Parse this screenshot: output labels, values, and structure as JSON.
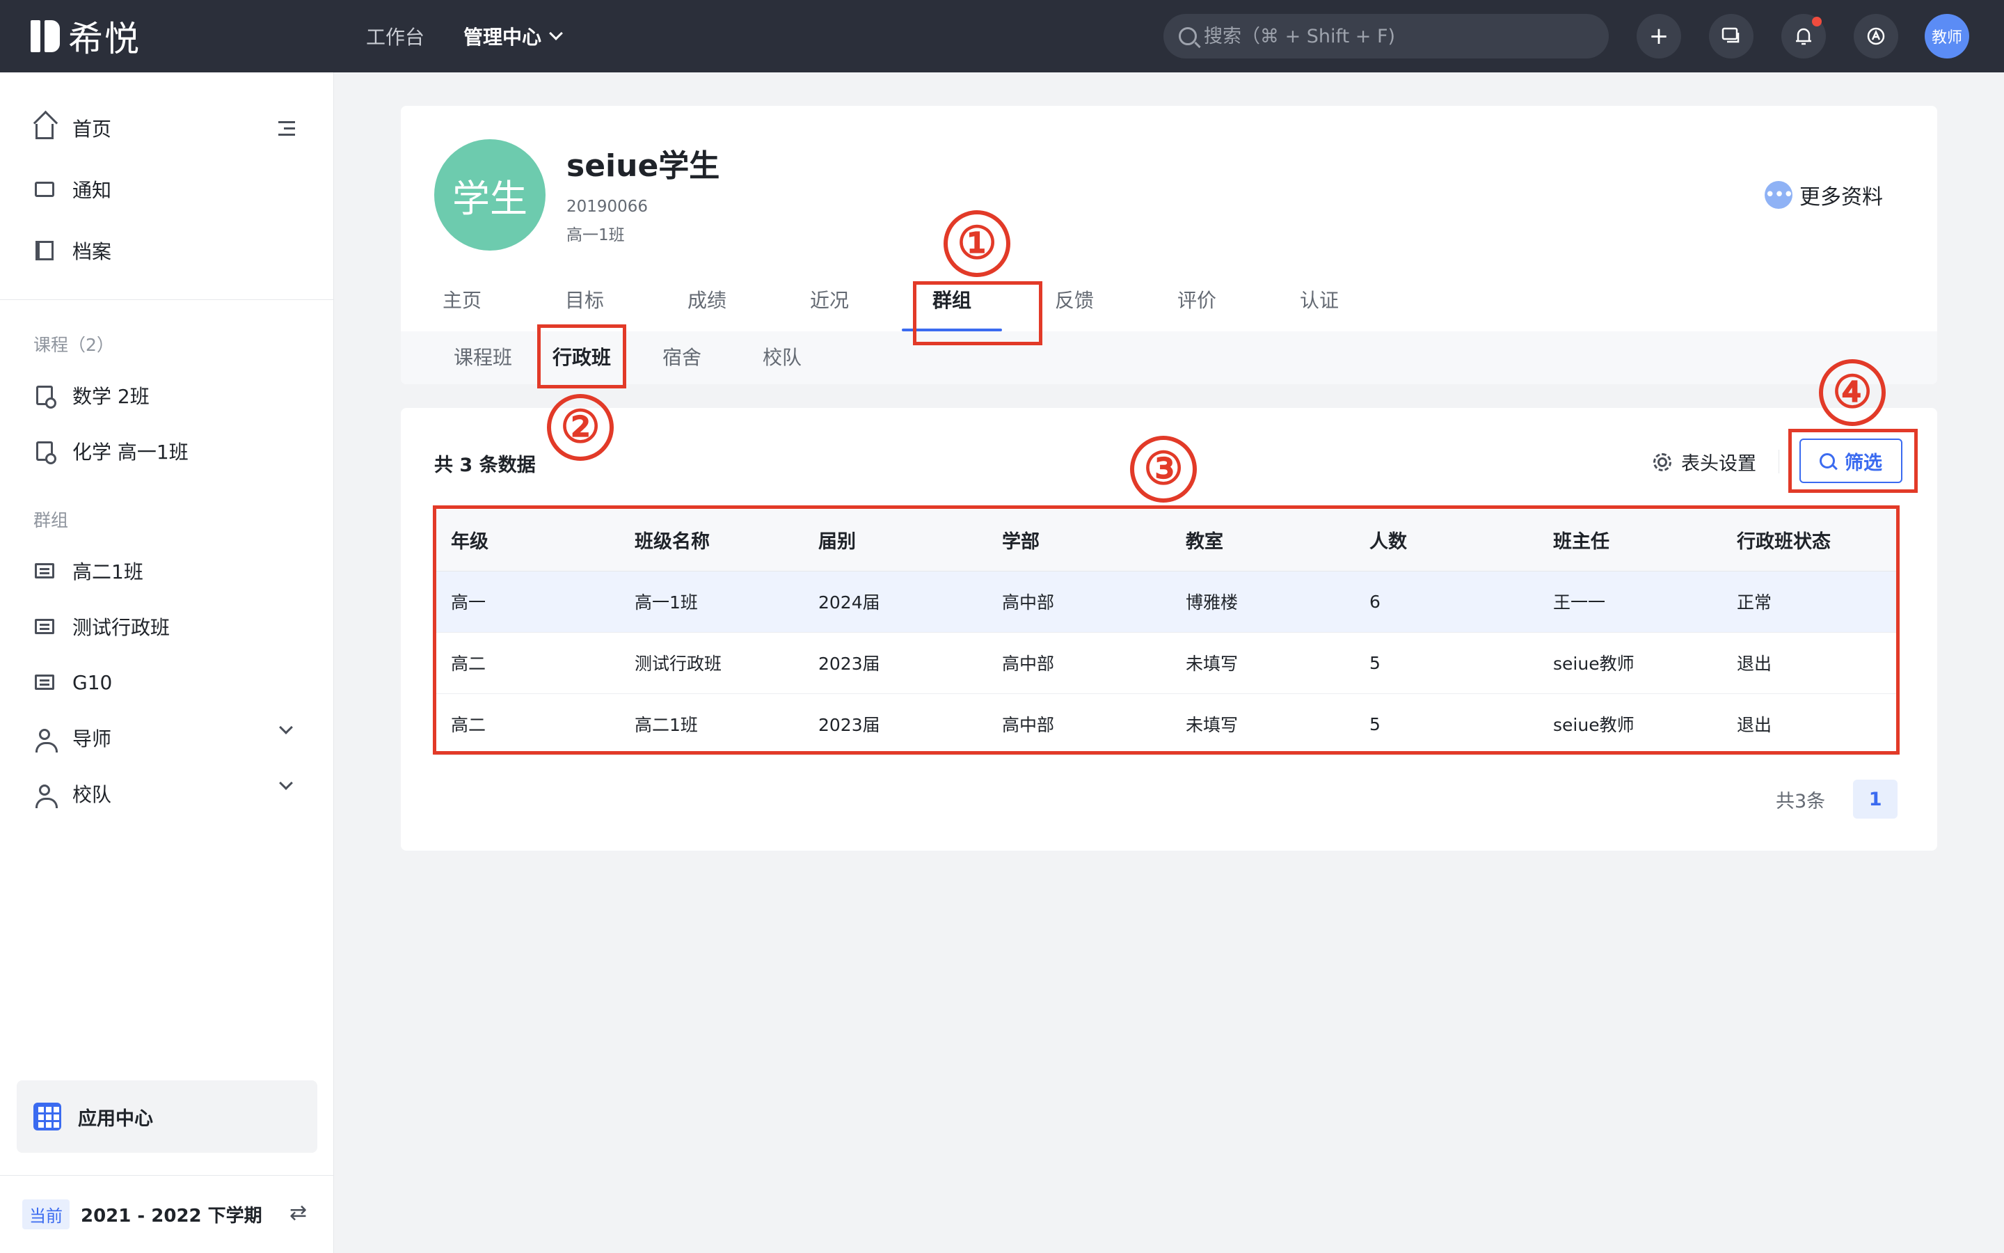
{
  "header": {
    "logo_text": "希悦",
    "nav": {
      "workbench": "工作台",
      "admin_center": "管理中心"
    },
    "search_placeholder": "搜索（⌘ + Shift + F)",
    "avatar_label": "教师",
    "icons": [
      "plus-icon",
      "chat-icon",
      "bell-icon",
      "assistant-icon"
    ],
    "notification_dot_color": "#f04c3e"
  },
  "sidebar": {
    "top_items": [
      {
        "label": "首页",
        "icon": "home-icon"
      },
      {
        "label": "通知",
        "icon": "message-icon"
      },
      {
        "label": "档案",
        "icon": "archive-icon"
      }
    ],
    "courses_heading": "课程（2）",
    "courses": [
      {
        "label": "数学 2班",
        "icon": "course-icon"
      },
      {
        "label": "化学 高一1班",
        "icon": "course-icon"
      }
    ],
    "groups_heading": "群组",
    "groups": [
      {
        "label": "高二1班",
        "icon": "class-icon"
      },
      {
        "label": "测试行政班",
        "icon": "class-icon"
      },
      {
        "label": "G10",
        "icon": "class-icon"
      },
      {
        "label": "导师",
        "icon": "mentor-icon",
        "expandable": true
      },
      {
        "label": "校队",
        "icon": "team-icon",
        "expandable": true
      }
    ],
    "app_center": "应用中心",
    "term_tag": "当前",
    "term": "2021 - 2022 下学期"
  },
  "profile": {
    "avatar_text": "学生",
    "avatar_color": "#6dcbae",
    "name": "seiue学生",
    "student_id": "20190066",
    "class_name": "高一1班",
    "more_info": "更多资料",
    "tabs": [
      "主页",
      "目标",
      "成绩",
      "近况",
      "群组",
      "反馈",
      "评价",
      "认证"
    ],
    "active_tab": "群组",
    "sub_tabs": [
      "课程班",
      "行政班",
      "宿舍",
      "校队"
    ],
    "active_sub_tab": "行政班"
  },
  "list": {
    "count_text": "共 3 条数据",
    "column_settings": "表头设置",
    "filter": "筛选",
    "columns": [
      "年级",
      "班级名称",
      "届别",
      "学部",
      "教室",
      "人数",
      "班主任",
      "行政班状态"
    ],
    "rows": [
      [
        "高一",
        "高一1班",
        "2024届",
        "高中部",
        "博雅楼",
        "6",
        "王一一",
        "正常"
      ],
      [
        "高二",
        "测试行政班",
        "2023届",
        "高中部",
        "未填写",
        "5",
        "seiue教师",
        "退出"
      ],
      [
        "高二",
        "高二1班",
        "2023届",
        "高中部",
        "未填写",
        "5",
        "seiue教师",
        "退出"
      ]
    ],
    "total_text": "共3条",
    "current_page": "1"
  },
  "annotations": [
    "①",
    "②",
    "③",
    "④"
  ],
  "accent_color": "#3b6bf0",
  "annotation_color": "#e23a28"
}
